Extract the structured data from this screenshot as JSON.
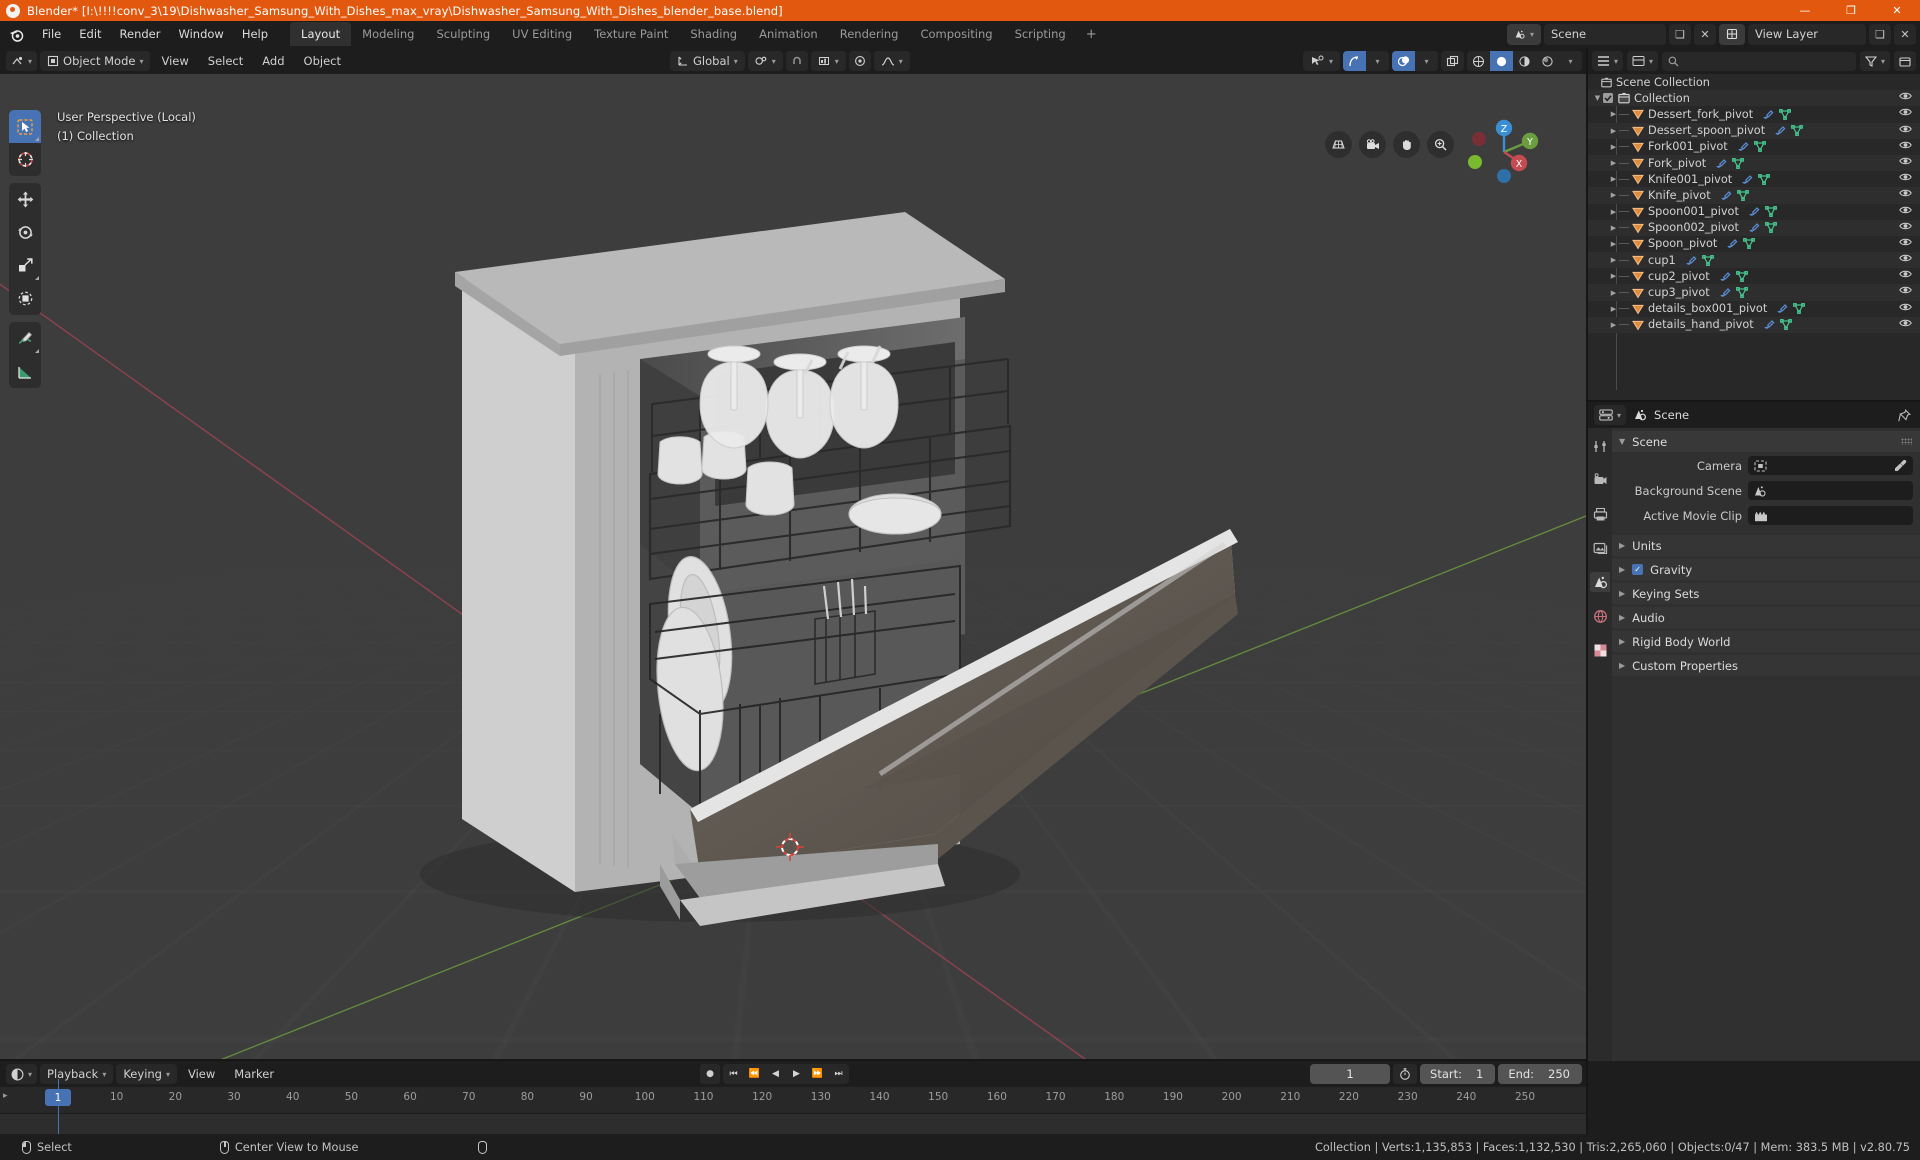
{
  "titlebar": {
    "title": "Blender* [I:\\!!!!conv_3\\19\\Dishwasher_Samsung_With_Dishes_max_vray\\Dishwasher_Samsung_With_Dishes_blender_base.blend]",
    "minimize": "—",
    "maximize": "❐",
    "close": "✕",
    "accent": "#e1580e"
  },
  "topbar": {
    "menus": [
      "File",
      "Edit",
      "Render",
      "Window",
      "Help"
    ],
    "workspaces": [
      {
        "label": "Layout",
        "active": true
      },
      {
        "label": "Modeling",
        "active": false
      },
      {
        "label": "Sculpting",
        "active": false
      },
      {
        "label": "UV Editing",
        "active": false
      },
      {
        "label": "Texture Paint",
        "active": false
      },
      {
        "label": "Shading",
        "active": false
      },
      {
        "label": "Animation",
        "active": false
      },
      {
        "label": "Rendering",
        "active": false
      },
      {
        "label": "Compositing",
        "active": false
      },
      {
        "label": "Scripting",
        "active": false
      }
    ],
    "add_workspace": "+",
    "scene_name": "Scene",
    "view_layer_label": "View Layer"
  },
  "viewport": {
    "mode": "Object Mode",
    "menus": [
      "View",
      "Select",
      "Add",
      "Object"
    ],
    "transform_orientation": "Global",
    "overlay_line1": "User Perspective (Local)",
    "overlay_line2": "(1) Collection",
    "gizmo_axes": {
      "z": "Z",
      "y": "Y",
      "x": "X"
    },
    "tools": [
      {
        "name": "tweak-select-tool",
        "active": true
      },
      {
        "name": "cursor-tool",
        "active": false
      },
      {
        "name": "move-tool",
        "active": false
      },
      {
        "name": "rotate-tool",
        "active": false
      },
      {
        "name": "scale-tool",
        "active": false
      },
      {
        "name": "transform-tool",
        "active": false
      },
      {
        "name": "annotate-tool",
        "active": false
      },
      {
        "name": "measure-tool",
        "active": false
      }
    ],
    "nav_buttons": [
      "grid-icon",
      "camera-icon",
      "hand-icon",
      "zoom-icon"
    ]
  },
  "outliner": {
    "display_mode": "View Layer",
    "search_placeholder": "",
    "root": "Scene Collection",
    "collection": "Collection",
    "items": [
      "Dessert_fork_pivot",
      "Dessert_spoon_pivot",
      "Fork001_pivot",
      "Fork_pivot",
      "Knife001_pivot",
      "Knife_pivot",
      "Spoon001_pivot",
      "Spoon002_pivot",
      "Spoon_pivot",
      "cup1",
      "cup2_pivot",
      "cup3_pivot",
      "details_box001_pivot",
      "details_hand_pivot"
    ]
  },
  "properties": {
    "breadcrumb": "Scene",
    "panel_scene": "Scene",
    "rows": [
      {
        "label": "Camera",
        "value": "",
        "icon": "camera-data-icon",
        "eyedropper": true
      },
      {
        "label": "Background Scene",
        "value": "",
        "icon": "scene-icon",
        "eyedropper": false
      },
      {
        "label": "Active Movie Clip",
        "value": "",
        "icon": "clip-icon",
        "eyedropper": false
      }
    ],
    "closed_panels": [
      {
        "label": "Units",
        "checkbox": false
      },
      {
        "label": "Gravity",
        "checkbox": true
      },
      {
        "label": "Keying Sets",
        "checkbox": false
      },
      {
        "label": "Audio",
        "checkbox": false
      },
      {
        "label": "Rigid Body World",
        "checkbox": false
      },
      {
        "label": "Custom Properties",
        "checkbox": false
      }
    ],
    "tabs": [
      "tool-icon",
      "render-icon",
      "output-icon",
      "view-layer-icon",
      "scene-icon",
      "world-icon",
      "texture-icon"
    ]
  },
  "timeline": {
    "menus": [
      "Playback",
      "Keying",
      "View",
      "Marker"
    ],
    "current_frame": "1",
    "start_label": "Start:",
    "start_value": "1",
    "end_label": "End:",
    "end_value": "250",
    "playhead_frame": "1",
    "ticks": [
      "10",
      "20",
      "30",
      "40",
      "50",
      "60",
      "70",
      "80",
      "90",
      "100",
      "110",
      "120",
      "130",
      "140",
      "150",
      "160",
      "170",
      "180",
      "190",
      "200",
      "210",
      "220",
      "230",
      "240",
      "250"
    ]
  },
  "statusbar": {
    "left_items": [
      {
        "icon": "mouse-left-icon",
        "label": "Select"
      },
      {
        "icon": "mouse-middle-icon",
        "label": "Center View to Mouse"
      },
      {
        "icon": "mouse-right-icon",
        "label": ""
      }
    ],
    "stats": "Collection | Verts:1,135,853 | Faces:1,132,530 | Tris:2,265,060 | Objects:0/47 | Mem: 383.5 MB | v2.80.75"
  },
  "colors": {
    "accent_blue": "#4772b3",
    "orange": "#e1580e",
    "panel_bg": "#303030",
    "viewport_bg": "#3d3d3d",
    "header_bg": "#1d1d1d"
  }
}
